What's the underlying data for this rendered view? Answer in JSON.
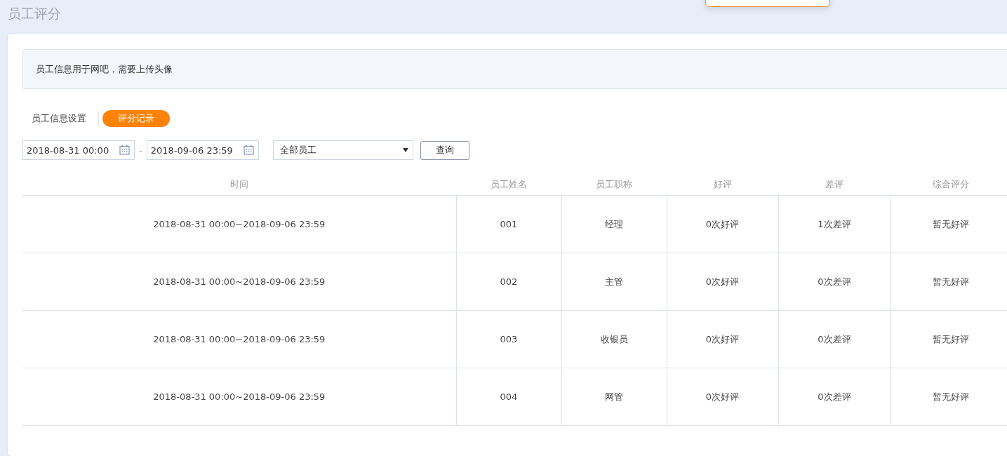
{
  "page": {
    "title": "员工评分"
  },
  "notice": "员工信息用于网吧，需要上传头像",
  "tabs": [
    {
      "label": "员工信息设置",
      "selected": false
    },
    {
      "label": "评分记录",
      "selected": true
    }
  ],
  "filters": {
    "start": "2018-08-31 00:00",
    "separator": "-",
    "end": "2018-09-06 23:59",
    "employee": "全部员工",
    "query_button": "查询"
  },
  "table": {
    "columns": [
      "时间",
      "员工姓名",
      "员工职称",
      "好评",
      "差评",
      "综合评分"
    ],
    "rows": [
      [
        "2018-08-31 00:00~2018-09-06 23:59",
        "001",
        "经理",
        "0次好评",
        "1次差评",
        "暂无好评"
      ],
      [
        "2018-08-31 00:00~2018-09-06 23:59",
        "002",
        "主管",
        "0次好评",
        "0次差评",
        "暂无好评"
      ],
      [
        "2018-08-31 00:00~2018-09-06 23:59",
        "003",
        "收银员",
        "0次好评",
        "0次差评",
        "暂无好评"
      ],
      [
        "2018-08-31 00:00~2018-09-06 23:59",
        "004",
        "网管",
        "0次好评",
        "0次差评",
        "暂无好评"
      ]
    ]
  }
}
